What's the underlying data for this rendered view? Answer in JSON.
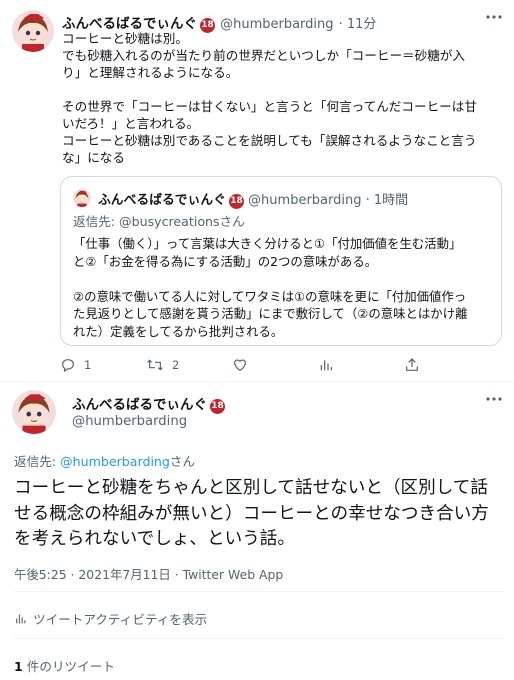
{
  "tweet1": {
    "name": "ふんべるばるでぃんぐ",
    "badge": "18",
    "handle": "@humberbarding",
    "time": "· 11分",
    "body": "コーヒーと砂糖は別。\nでも砂糖入れるのが当たり前の世界だといつしか「コーヒー＝砂糖が入\nり」と理解されるようになる。\n\nその世界で「コーヒーは甘くない」と言うと「何言ってんだコーヒーは甘\nいだろ！」と言われる。\nコーヒーと砂糖は別であることを説明しても「誤解されるようなこと言う\nな」になる",
    "more_icon": "more-horizontal-icon",
    "quote": {
      "name": "ふんべるばるでぃんぐ",
      "badge": "18",
      "handle": "@humberbarding",
      "time": "· 1時間",
      "reply_to": "返信先: @busycreationsさん",
      "body": "「仕事（働く）」って言葉は大きく分けると①「付加価値を生む活動」\nと②「お金を得る為にする活動」の2つの意味がある。\n\n②の意味で働いてる人に対してワタミは①の意味を更に「付加価値作っ\nた見返りとして感謝を貰う活動」にまで敷衍して（②の意味とはかけ離\nれた）定義をしてるから批判される。"
    },
    "actions": {
      "reply_count": "1",
      "retweet_count": "2",
      "like_count": "",
      "icons": [
        "reply-icon",
        "retweet-icon",
        "like-icon",
        "analytics-icon",
        "share-icon"
      ]
    }
  },
  "tweet2": {
    "name": "ふんべるばるでぃんぐ",
    "badge": "18",
    "handle": "@humberbarding",
    "reply_prefix": "返信先: ",
    "reply_link": "@humberbarding",
    "reply_suffix": "さん",
    "body": "コーヒーと砂糖をちゃんと区別して話せないと（区別して話せる概念の枠組みが無いと）コーヒーとの幸せなつき合い方を考えられないでしょ、という話。",
    "meta": "午後5:25 · 2021年7月11日 · Twitter Web App",
    "activity_label": "ツイートアクティビティを表示",
    "retweet_count": "1",
    "retweet_label": " 件のリツイート",
    "more_icon": "more-horizontal-icon"
  },
  "colors": {
    "link": "#1d9bf0",
    "muted": "#536471",
    "text": "#0f1419",
    "border": "#cfd9de",
    "badge": "#c0242c"
  }
}
